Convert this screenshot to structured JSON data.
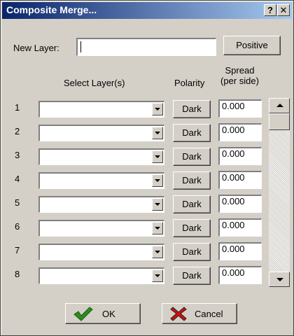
{
  "window": {
    "title": "Composite Merge...",
    "help_label": "?",
    "close_label": "✕"
  },
  "new_layer": {
    "label": "New Layer:",
    "value": "",
    "positive_label": "Positive"
  },
  "headers": {
    "select_layers": "Select Layer(s)",
    "polarity": "Polarity",
    "spread_line1": "Spread",
    "spread_line2": "(per side)"
  },
  "rows": [
    {
      "num": "1",
      "layer": "",
      "polarity": "Dark",
      "spread": "0.000"
    },
    {
      "num": "2",
      "layer": "",
      "polarity": "Dark",
      "spread": "0.000"
    },
    {
      "num": "3",
      "layer": "",
      "polarity": "Dark",
      "spread": "0.000"
    },
    {
      "num": "4",
      "layer": "",
      "polarity": "Dark",
      "spread": "0.000"
    },
    {
      "num": "5",
      "layer": "",
      "polarity": "Dark",
      "spread": "0.000"
    },
    {
      "num": "6",
      "layer": "",
      "polarity": "Dark",
      "spread": "0.000"
    },
    {
      "num": "7",
      "layer": "",
      "polarity": "Dark",
      "spread": "0.000"
    },
    {
      "num": "8",
      "layer": "",
      "polarity": "Dark",
      "spread": "0.000"
    }
  ],
  "footer": {
    "ok_label": "OK",
    "cancel_label": "Cancel"
  },
  "icons": {
    "ok_icon": "checkmark-icon",
    "cancel_icon": "red-x-icon"
  },
  "colors": {
    "title_start": "#0a246a",
    "title_end": "#a6caf0",
    "ok_check": "#2e8b1e",
    "cancel_x": "#d01010",
    "dialog_face": "#d4d0c8"
  }
}
